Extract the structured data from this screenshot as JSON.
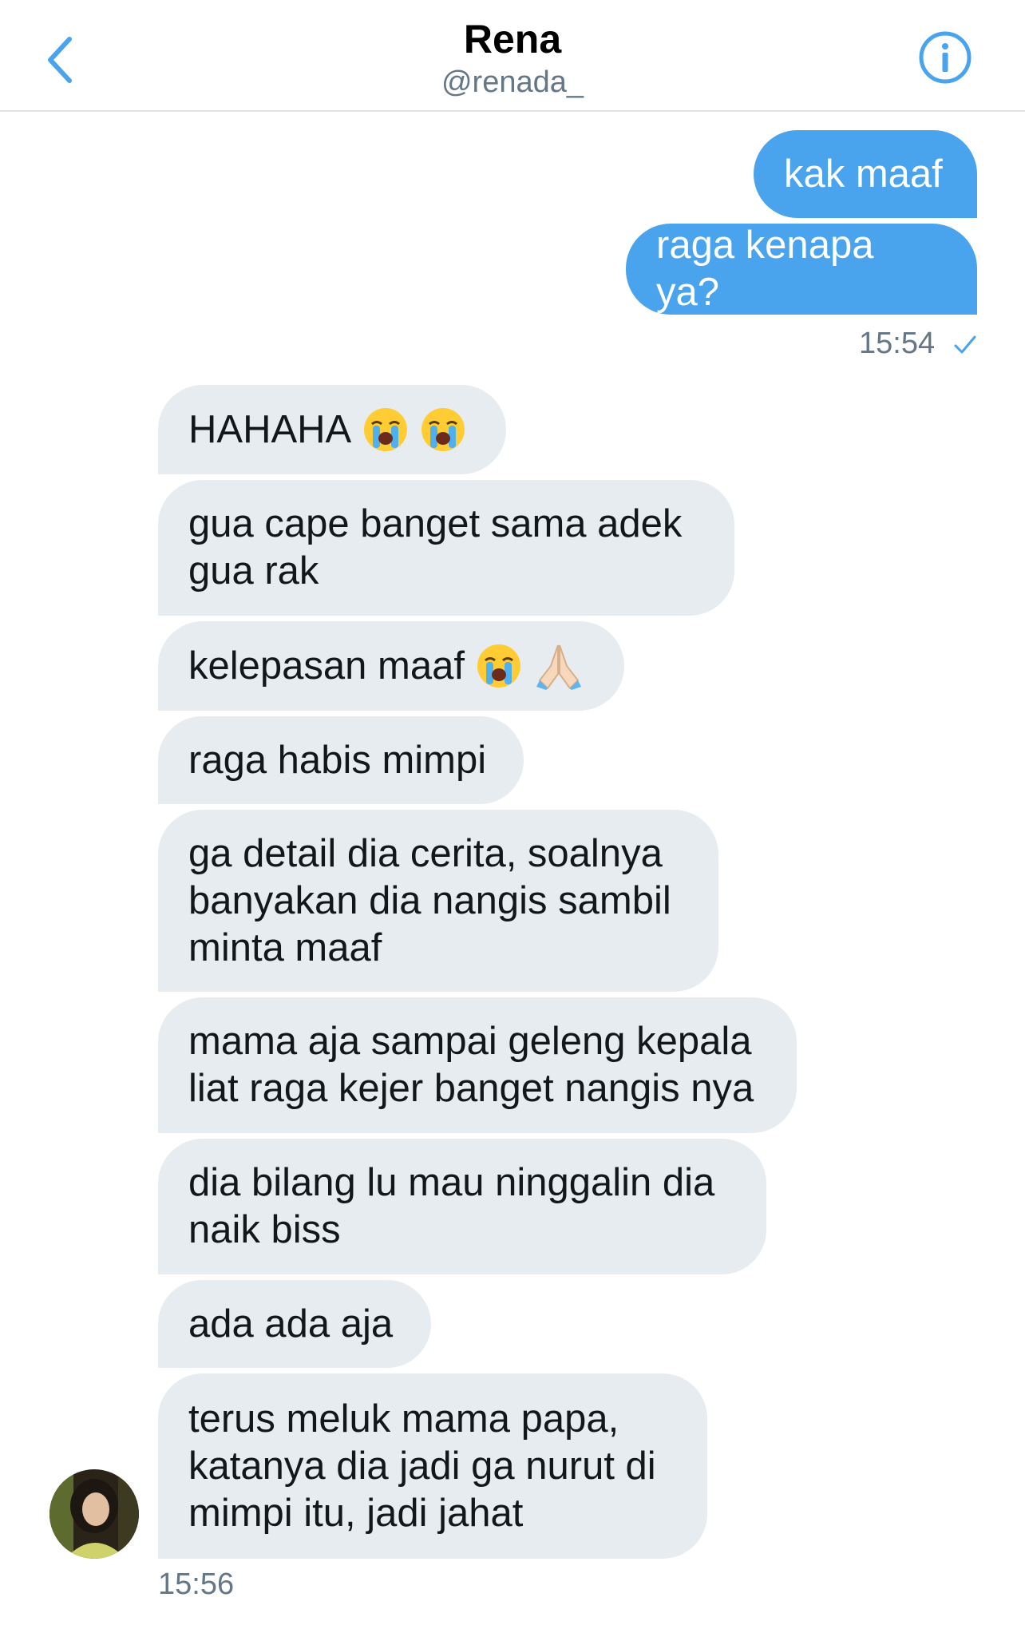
{
  "header": {
    "title": "Rena",
    "handle": "@renada_"
  },
  "colors": {
    "accent": "#4aa3ed",
    "incoming_bubble": "#e6ecf0",
    "muted_text": "#657786"
  },
  "messages": {
    "out_1": "kak maaf",
    "out_2": "raga kenapa ya?",
    "out_time": "15:54",
    "in_1": "HAHAHA",
    "in_2": "gua cape banget sama adek\ngua rak",
    "in_3": "kelepasan maaf",
    "in_4": "raga habis mimpi",
    "in_5": "ga detail dia cerita, soalnya\nbanyakan dia nangis sambil\nminta maaf",
    "in_6": "mama aja sampai geleng kepala\nliat raga kejer banget nangis nya",
    "in_7": "dia bilang lu mau ninggalin dia\nnaik biss",
    "in_8": "ada ada aja",
    "in_9": "terus meluk mama papa,\nkatanya dia jadi ga nurut di\nmimpi itu, jadi jahat",
    "in_time": "15:56"
  },
  "icons": {
    "back": "chevron-left-icon",
    "info": "info-circle-icon",
    "read": "checkmark-icon",
    "crying": "loudly-crying-face-emoji",
    "pray": "folded-hands-emoji"
  }
}
